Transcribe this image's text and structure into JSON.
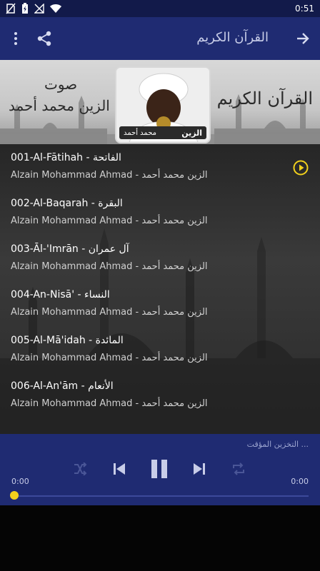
{
  "status_bar": {
    "time": "0:51"
  },
  "app_bar": {
    "title": "القرآن الكريم",
    "share_icon": "share-icon",
    "menu_icon": "more-vert-icon",
    "forward_icon": "arrow-forward-icon"
  },
  "banner": {
    "right_text": "القرآن الكريم",
    "left_text_1": "صوت",
    "left_text_2": "الزين محمد أحمد",
    "avatar_caption_right": "الزين",
    "avatar_caption_left": "محمد أحمد"
  },
  "tracks": [
    {
      "title": "001-Al-Fātihah - الفاتحة",
      "reciter": "Alzain Mohammad Ahmad - الزين محمد أحمد"
    },
    {
      "title": "002-Al-Baqarah - البقرة",
      "reciter": "Alzain Mohammad Ahmad - الزين محمد أحمد"
    },
    {
      "title": "003-Āl-'Imrān - آل عمران",
      "reciter": "Alzain Mohammad Ahmad - الزين محمد أحمد"
    },
    {
      "title": "004-An-Nisā' - النساء",
      "reciter": "Alzain Mohammad Ahmad - الزين محمد أحمد"
    },
    {
      "title": "005-Al-Mā'idah - المائدة",
      "reciter": "Alzain Mohammad Ahmad - الزين محمد أحمد"
    },
    {
      "title": "006-Al-An'ām - الأنعام",
      "reciter": "Alzain Mohammad Ahmad - الزين محمد أحمد"
    }
  ],
  "player": {
    "buffering_text": "التخزين المؤقت ...",
    "time_elapsed": "0:00",
    "time_total": "0:00",
    "progress": 0
  },
  "colors": {
    "app_bar": "#1f2b72",
    "status_bar": "#121a4a",
    "accent": "#f2d11c"
  }
}
